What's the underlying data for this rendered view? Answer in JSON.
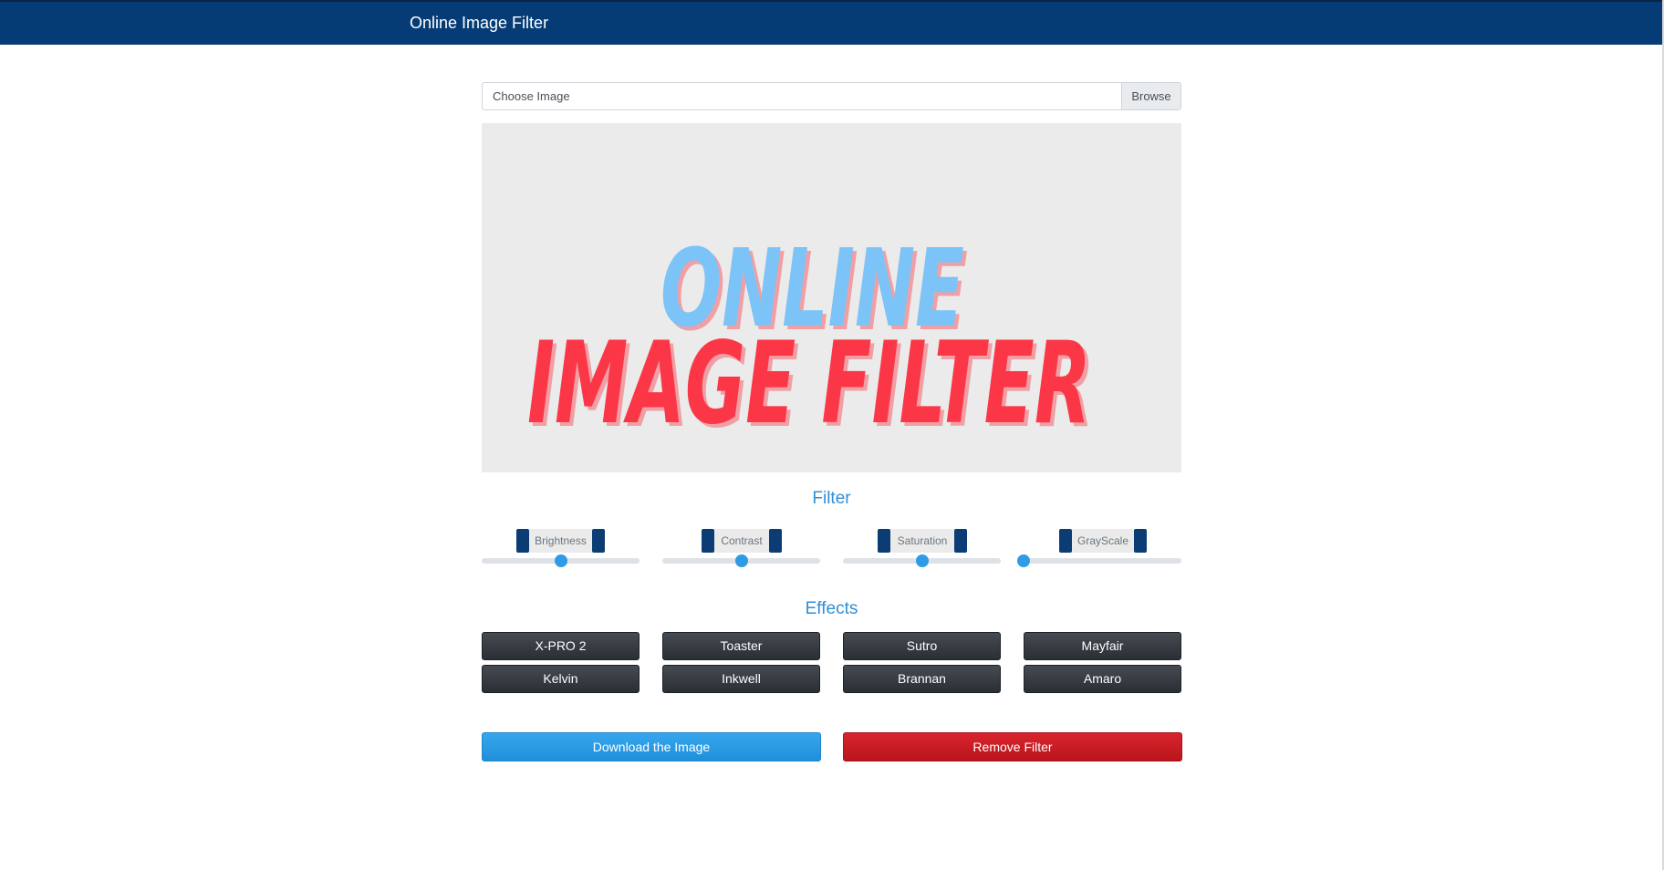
{
  "navbar": {
    "brand": "Online Image Filter"
  },
  "file_input": {
    "placeholder": "Choose Image",
    "browse_label": "Browse"
  },
  "preview": {
    "line1": "ONLINE",
    "line2": "IMAGE FILTER",
    "line1_color": "#7cc3f7",
    "line2_color": "#fb3747",
    "shadow_color": "#f0a0a5",
    "background": "#ebebeb"
  },
  "filter": {
    "title": "Filter",
    "sliders": [
      {
        "label": "Brightness",
        "value": 0.5
      },
      {
        "label": "Contrast",
        "value": 0.5
      },
      {
        "label": "Saturation",
        "value": 0.5
      },
      {
        "label": "GrayScale",
        "value": 0
      }
    ]
  },
  "effects": {
    "title": "Effects",
    "buttons": [
      [
        "X-PRO 2",
        "Toaster",
        "Sutro",
        "Mayfair"
      ],
      [
        "Kelvin",
        "Inkwell",
        "Brannan",
        "Amaro"
      ]
    ]
  },
  "actions": {
    "download_label": "Download the Image",
    "remove_label": "Remove Filter"
  },
  "colors": {
    "navbar": "#063c76",
    "accent": "#2f8fd8",
    "download": "#2f9be5",
    "remove": "#c91d24"
  }
}
